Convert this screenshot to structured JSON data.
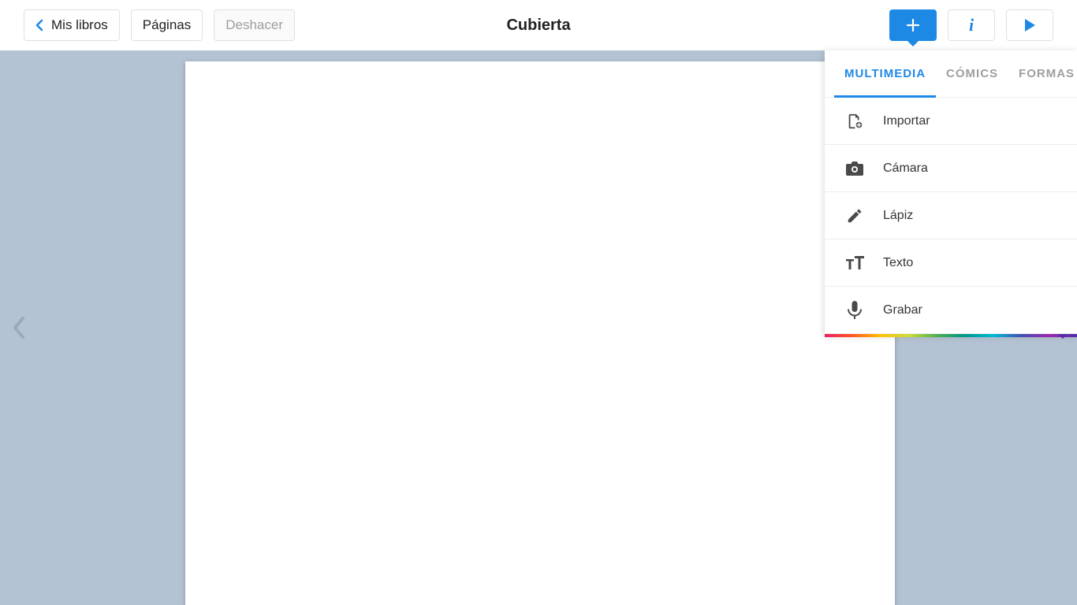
{
  "toolbar": {
    "back_label": "Mis libros",
    "pages_label": "Páginas",
    "undo_label": "Deshacer",
    "title": "Cubierta"
  },
  "panel": {
    "tabs": {
      "multimedia": "MULTIMEDIA",
      "comics": "CÓMICS",
      "shapes": "FORMAS"
    },
    "items": {
      "import": "Importar",
      "camera": "Cámara",
      "pencil": "Lápiz",
      "text": "Texto",
      "record": "Grabar"
    }
  }
}
